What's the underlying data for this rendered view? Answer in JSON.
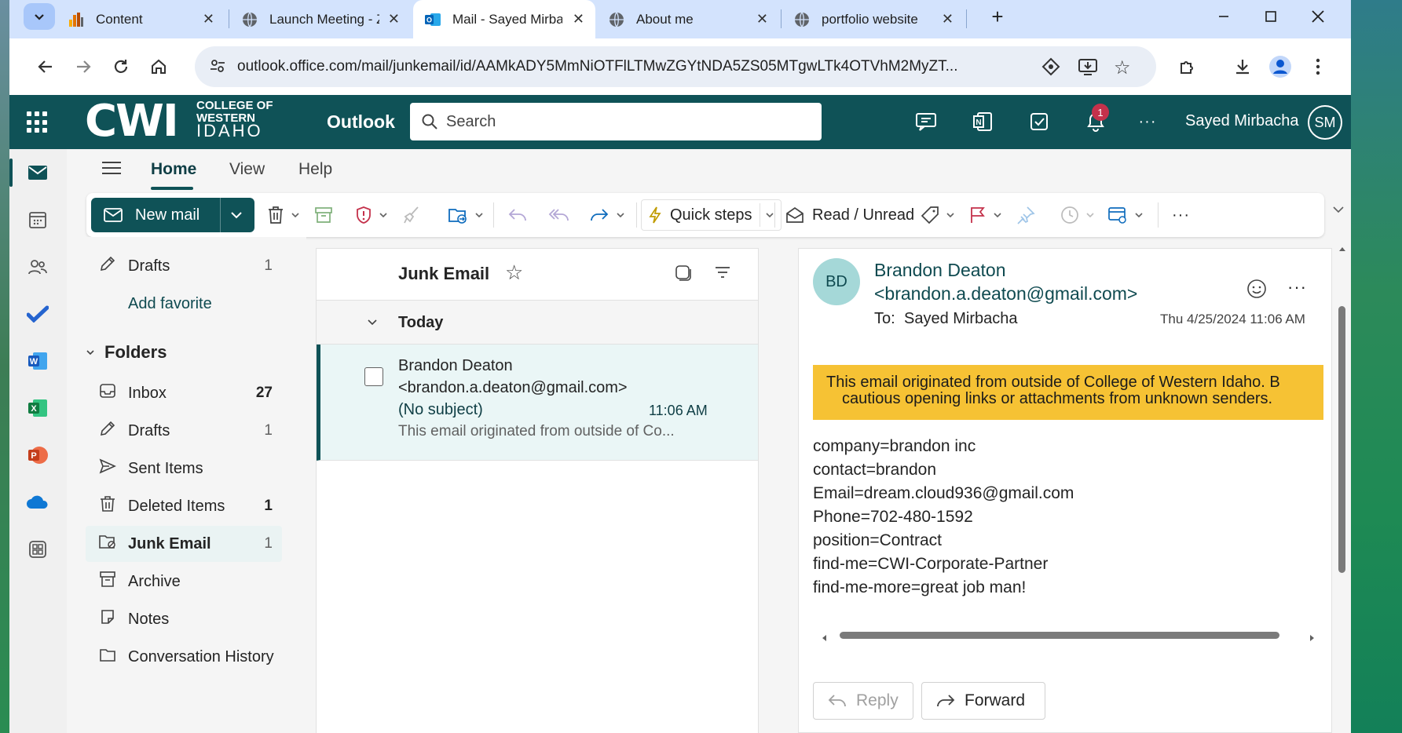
{
  "browser": {
    "tabs": [
      {
        "title": "Content",
        "icon": "chart-bars-icon"
      },
      {
        "title": "Launch Meeting - Z",
        "icon": "globe-icon"
      },
      {
        "title": "Mail - Sayed Mirbacha",
        "icon": "outlook-icon",
        "active": true
      },
      {
        "title": "About me",
        "icon": "globe-icon"
      },
      {
        "title": "portfolio website",
        "icon": "globe-icon"
      }
    ],
    "url": "outlook.office.com/mail/junkemail/id/AAMkADY5MmNiOTFlLTMwZGYtNDA5ZS05MTgwLTk4OTVhM2MyZT..."
  },
  "header": {
    "logo_main": "CWI",
    "logo_line1": "COLLEGE OF",
    "logo_line2": "WESTERN",
    "logo_line3": "IDAHO",
    "app_name": "Outlook",
    "search_placeholder": "Search",
    "notification_count": "1",
    "more": "···",
    "user_name": "Sayed Mirbacha",
    "user_initials": "SM"
  },
  "ribbon": {
    "tabs": [
      "Home",
      "View",
      "Help"
    ],
    "new_mail": "New mail",
    "quick_steps": "Quick steps",
    "read_unread": "Read / Unread",
    "more": "···"
  },
  "folders": {
    "favorites": [
      {
        "label": "Drafts",
        "count": "1",
        "icon": "pencil-icon"
      }
    ],
    "add_favorite": "Add favorite",
    "heading": "Folders",
    "items": [
      {
        "label": "Inbox",
        "count": "27",
        "bold_count": true,
        "icon": "inbox-icon"
      },
      {
        "label": "Drafts",
        "count": "1",
        "icon": "pencil-icon"
      },
      {
        "label": "Sent Items",
        "count": "",
        "icon": "send-icon"
      },
      {
        "label": "Deleted Items",
        "count": "1",
        "bold_count": true,
        "icon": "trash-icon"
      },
      {
        "label": "Junk Email",
        "count": "1",
        "selected": true,
        "icon": "junk-icon"
      },
      {
        "label": "Archive",
        "count": "",
        "icon": "archive-icon"
      },
      {
        "label": "Notes",
        "count": "",
        "icon": "note-icon"
      },
      {
        "label": "Conversation History",
        "count": "",
        "icon": "folder-icon"
      }
    ]
  },
  "message_list": {
    "title": "Junk Email",
    "group": "Today",
    "messages": [
      {
        "sender_name": "Brandon Deaton",
        "sender_email": "<brandon.a.deaton@gmail.com>",
        "subject": "(No subject)",
        "time": "11:06 AM",
        "preview": "This email originated from outside of Co..."
      }
    ]
  },
  "reading_pane": {
    "avatar_initials": "BD",
    "sender_name": "Brandon Deaton",
    "sender_email": "<brandon.a.deaton@gmail.com>",
    "to_label": "To:",
    "to_name": "Sayed Mirbacha",
    "datetime": "Thu 4/25/2024 11:06 AM",
    "warning_line1": "This email originated from outside of College of Western Idaho. B",
    "warning_line2": "cautious opening links or attachments from unknown senders.",
    "body_lines": [
      "company=brandon inc",
      "contact=brandon",
      "Email=dream.cloud936@gmail.com",
      "Phone=702-480-1592",
      "position=Contract",
      "find-me=CWI-Corporate-Partner",
      "find-me-more=great job man!"
    ],
    "reply": "Reply",
    "forward": "Forward"
  },
  "colors": {
    "header_bg": "#0f5257",
    "warning_bg": "#f6c234",
    "tabstrip_bg": "#d3e3fd",
    "notification_red": "#c4314b"
  }
}
